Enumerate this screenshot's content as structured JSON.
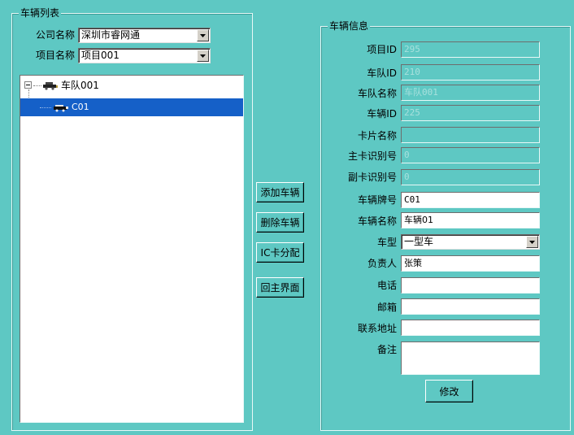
{
  "vehicle_list": {
    "group_title": "车辆列表",
    "company_label": "公司名称",
    "company_value": "深圳市睿网通",
    "project_label": "项目名称",
    "project_value": "项目001",
    "tree": {
      "fleet": "车队001",
      "vehicle": "C01"
    }
  },
  "actions": {
    "add_vehicle": "添加车辆",
    "delete_vehicle": "删除车辆",
    "ic_card": "IC卡分配",
    "back_main": "回主界面"
  },
  "vehicle_info": {
    "group_title": "车辆信息",
    "fields": [
      {
        "label": "项目ID",
        "value": "295"
      },
      {
        "label": "车队ID",
        "value": "210"
      },
      {
        "label": "车队名称",
        "value": "车队001"
      },
      {
        "label": "车辆ID",
        "value": "225"
      },
      {
        "label": "卡片名称",
        "value": ""
      },
      {
        "label": "主卡识别号",
        "value": "0"
      },
      {
        "label": "副卡识别号",
        "value": "0"
      },
      {
        "label": "车辆牌号",
        "value": "C01"
      },
      {
        "label": "车辆名称",
        "value": "车辆01"
      },
      {
        "label": "车型",
        "value": "一型车"
      },
      {
        "label": "负责人",
        "value": "张策"
      },
      {
        "label": "电话",
        "value": ""
      },
      {
        "label": "邮箱",
        "value": ""
      },
      {
        "label": "联系地址",
        "value": ""
      },
      {
        "label": "备注",
        "value": ""
      }
    ],
    "modify_button": "修改"
  }
}
